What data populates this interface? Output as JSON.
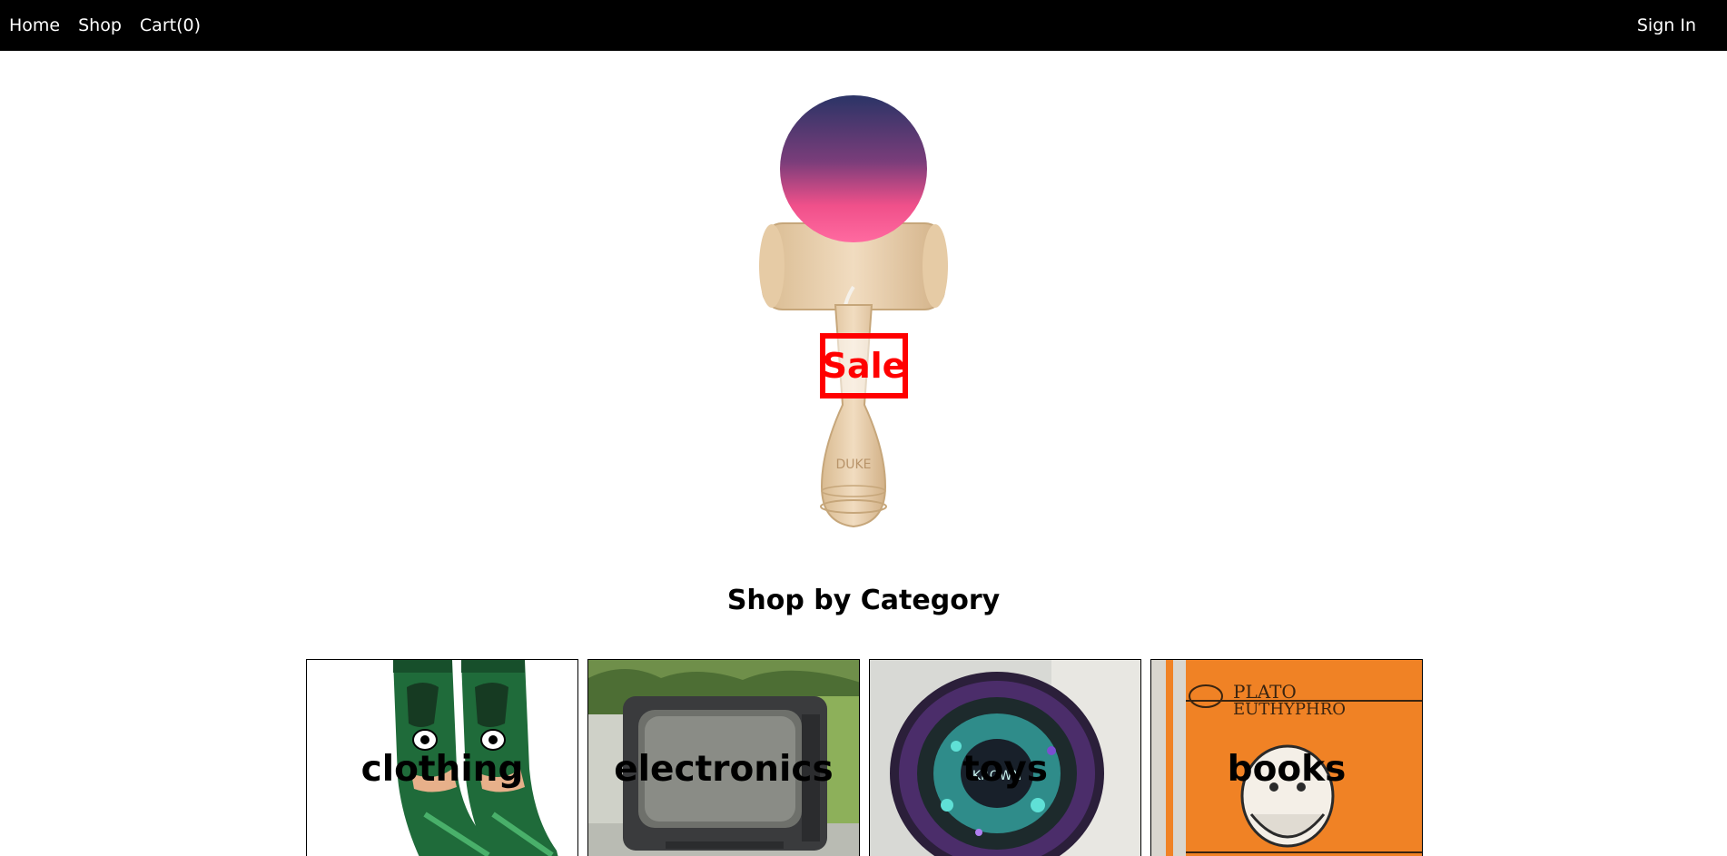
{
  "nav": {
    "links": [
      {
        "label": "Home"
      },
      {
        "label": "Shop"
      },
      {
        "label": "Cart(0)"
      }
    ],
    "sign_in": "Sign In"
  },
  "hero": {
    "badge": "Sale",
    "product_icon": "kendama-image",
    "engraving": "DUKE"
  },
  "categories_section": {
    "title": "Shop by Category",
    "items": [
      {
        "label": "clothing",
        "image": "socks-image"
      },
      {
        "label": "electronics",
        "image": "crt-television-image"
      },
      {
        "label": "toys",
        "image": "yoyo-image"
      },
      {
        "label": "books",
        "image": "plato-euthyphro-book-image",
        "cover_title_1": "PLATO",
        "cover_title_2": "EUTHYPHRO"
      }
    ]
  },
  "colors": {
    "nav_bg": "#000000",
    "nav_text": "#ffffff",
    "sale": "#ff0000"
  }
}
